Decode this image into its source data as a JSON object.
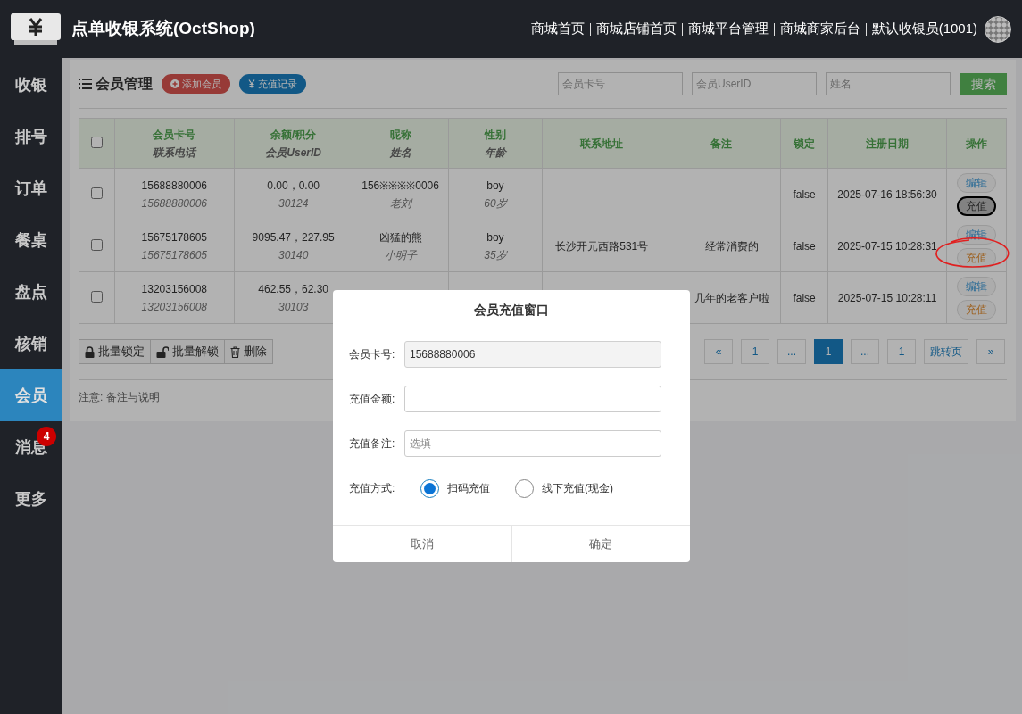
{
  "header": {
    "title": "点单收银系统(OctShop)",
    "links": [
      "商城首页",
      "商城店铺首页",
      "商城平台管理",
      "商城商家后台",
      "默认收银员(1001)"
    ]
  },
  "sidebar": {
    "items": [
      {
        "label": "收银",
        "selected": false
      },
      {
        "label": "排号",
        "selected": false
      },
      {
        "label": "订单",
        "selected": false
      },
      {
        "label": "餐桌",
        "selected": false
      },
      {
        "label": "盘点",
        "selected": false
      },
      {
        "label": "核销",
        "selected": false
      },
      {
        "label": "会员",
        "selected": true
      },
      {
        "label": "消息",
        "selected": false,
        "badge": "4"
      },
      {
        "label": "更多",
        "selected": false
      }
    ]
  },
  "panel": {
    "title": "会员管理",
    "buttons": [
      {
        "label": "添加会员",
        "kind": "add"
      },
      {
        "label": "充值记录",
        "kind": "recharge"
      }
    ],
    "search_fields": [
      {
        "placeholder": "会员卡号"
      },
      {
        "placeholder": "会员UserID"
      },
      {
        "placeholder": "姓名"
      }
    ],
    "search_button": "搜索"
  },
  "table": {
    "select_all_checked": false,
    "columns": [
      {
        "title": "会员卡号",
        "subtitle": "联系电话"
      },
      {
        "title": "余额/积分",
        "subtitle": "会员UserID"
      },
      {
        "title": "昵称",
        "subtitle": "姓名"
      },
      {
        "title": "性别",
        "subtitle": "年龄"
      },
      {
        "title": "联系地址"
      },
      {
        "title": "备注"
      },
      {
        "title": "锁定"
      },
      {
        "title": "注册日期"
      },
      {
        "title": "操作"
      }
    ],
    "rows": [
      {
        "checked": false,
        "cells": [
          {
            "text": "15688880006",
            "sub": "15688880006"
          },
          {
            "text": "0.00，0.00",
            "sub": "30124"
          },
          {
            "text": "156※※※※0006",
            "sub": "老刘"
          },
          {
            "text": "boy",
            "sub": "60岁"
          },
          {},
          {},
          {
            "text": "false"
          },
          {
            "text": "2025-07-16 18:56:30"
          }
        ],
        "actions": [
          {
            "label": "编辑",
            "kind": "edit",
            "focused": false
          },
          {
            "label": "充值",
            "kind": "recharge",
            "focused": true
          }
        ]
      },
      {
        "checked": false,
        "cells": [
          {
            "text": "15675178605",
            "sub": "15675178605"
          },
          {
            "text": "9095.47，227.95",
            "sub": "30140"
          },
          {
            "text": "凶猛的熊",
            "sub": "小明子"
          },
          {
            "text": "boy",
            "sub": "35岁"
          },
          {
            "text": "长沙开元西路531号"
          },
          {
            "text": "经常消费的"
          },
          {
            "text": "false"
          },
          {
            "text": "2025-07-15 10:28:31"
          }
        ],
        "actions": [
          {
            "label": "编辑",
            "kind": "edit",
            "focused": false
          },
          {
            "label": "充值",
            "kind": "recharge",
            "focused": false
          }
        ]
      },
      {
        "checked": false,
        "cells": [
          {
            "text": "13203156008",
            "sub": "13203156008"
          },
          {
            "text": "462.55，62.30",
            "sub": "30103"
          },
          {},
          {},
          {},
          {
            "text": "几年的老客户啦"
          },
          {
            "text": "false"
          },
          {
            "text": "2025-07-15 10:28:11"
          }
        ],
        "actions": [
          {
            "label": "编辑",
            "kind": "edit",
            "focused": false
          },
          {
            "label": "充值",
            "kind": "recharge",
            "focused": false
          }
        ]
      }
    ]
  },
  "bulk_actions": [
    {
      "label": "批量锁定",
      "kind": "lock"
    },
    {
      "label": "批量解锁",
      "kind": "unlock"
    },
    {
      "label": "删除",
      "kind": "delete"
    }
  ],
  "pagination": [
    {
      "label": "«",
      "selected": false
    },
    {
      "label": "1",
      "selected": false
    },
    {
      "label": "...",
      "selected": false
    },
    {
      "label": "1",
      "selected": true
    },
    {
      "label": "...",
      "selected": false
    },
    {
      "label": "1",
      "selected": false
    },
    {
      "label": "跳转页",
      "selected": false
    },
    {
      "label": "»",
      "selected": false
    }
  ],
  "note": "注意: 备注与说明",
  "modal": {
    "title": "会员充值窗口",
    "fields": [
      {
        "label": "会员卡号:",
        "value": "15688880006",
        "readonly": true
      },
      {
        "label": "充值金额:",
        "readonly": false
      },
      {
        "label": "充值备注:",
        "placeholder": "选填",
        "readonly": false
      }
    ],
    "payment": {
      "label": "充值方式:",
      "options": [
        {
          "label": "扫码充值",
          "selected": true
        },
        {
          "label": "线下充值(现金)",
          "selected": false
        }
      ]
    },
    "buttons": [
      "取消",
      "确定"
    ]
  }
}
